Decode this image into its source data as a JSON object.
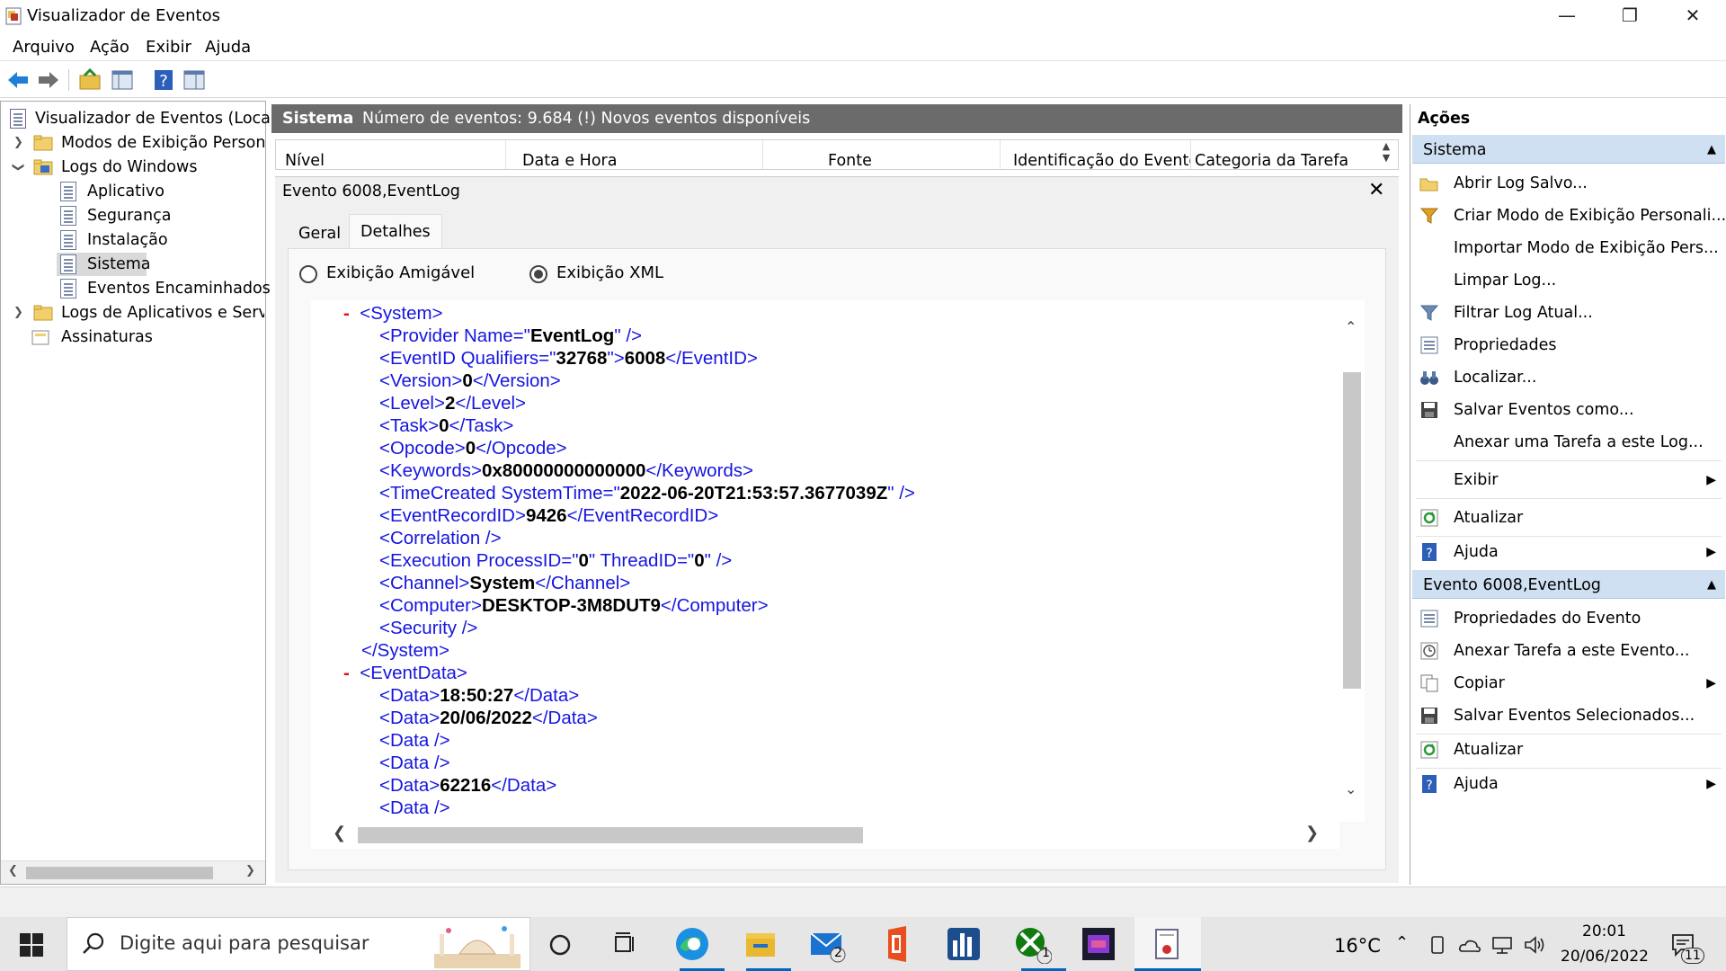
{
  "window": {
    "title": "Visualizador de Eventos"
  },
  "menu": [
    "Arquivo",
    "Ação",
    "Exibir",
    "Ajuda"
  ],
  "tree": {
    "root": "Visualizador de Eventos (Local)",
    "custom_views": "Modos de Exibição Personaliz",
    "windows_logs": "Logs do Windows",
    "app": "Aplicativo",
    "security": "Segurança",
    "setup": "Instalação",
    "system": "Sistema",
    "forwarded": "Eventos Encaminhados",
    "app_services": "Logs de Aplicativos e Serviços",
    "subscriptions": "Assinaturas"
  },
  "center": {
    "log_name": "Sistema",
    "status": "Número de eventos: 9.684 (!) Novos eventos disponíveis",
    "columns": [
      "Nível",
      "Data e Hora",
      "Fonte",
      "Identificação do Evento",
      "Categoria da Tarefa"
    ]
  },
  "event": {
    "title": "Evento 6008,EventLog",
    "tabs": [
      "Geral",
      "Detalhes"
    ],
    "radio_friendly": "Exibição Amigável",
    "radio_xml": "Exibição XML",
    "selected_view": "Exibição XML"
  },
  "xml": {
    "l1": "<System>",
    "l2_open": "<Provider Name=\"",
    "l2_val": "EventLog",
    "l2_close": "\" />",
    "l3_open": "<EventID Qualifiers=\"",
    "l3_val": "32768",
    "l3_mid": "\">",
    "l3_v2": "6008",
    "l3_close": "</EventID>",
    "l4_open": "<Version>",
    "l4_val": "0",
    "l4_close": "</Version>",
    "l5_open": "<Level>",
    "l5_val": "2",
    "l5_close": "</Level>",
    "l6_open": "<Task>",
    "l6_val": "0",
    "l6_close": "</Task>",
    "l7_open": "<Opcode>",
    "l7_val": "0",
    "l7_close": "</Opcode>",
    "l8_open": "<Keywords>",
    "l8_val": "0x80000000000000",
    "l8_close": "</Keywords>",
    "l9_open": "<TimeCreated SystemTime=\"",
    "l9_val": "2022-06-20T21:53:57.3677039Z",
    "l9_close": "\" />",
    "l10_open": "<EventRecordID>",
    "l10_val": "9426",
    "l10_close": "</EventRecordID>",
    "l11": "<Correlation />",
    "l12_open": "<Execution ProcessID=\"",
    "l12_val": "0",
    "l12_mid": "\" ThreadID=\"",
    "l12_v2": "0",
    "l12_close": "\" />",
    "l13_open": "<Channel>",
    "l13_val": "System",
    "l13_close": "</Channel>",
    "l14_open": "<Computer>",
    "l14_val": "DESKTOP-3M8DUT9",
    "l14_close": "</Computer>",
    "l15": "<Security />",
    "l16": "</System>",
    "l17": "<EventData>",
    "l18_open": "<Data>",
    "l18_val": "18:50:27",
    "l18_close": "</Data>",
    "l19_open": "<Data>",
    "l19_val": "20/06/2022",
    "l19_close": "</Data>",
    "l20": "<Data />",
    "l21": "<Data />",
    "l22_open": "<Data>",
    "l22_val": "62216",
    "l22_close": "</Data>",
    "l23": "<Data />",
    "minus": "-"
  },
  "actions": {
    "title": "Ações",
    "section1": "Sistema",
    "items1": [
      "Abrir Log Salvo...",
      "Criar Modo de Exibição Personali...",
      "Importar Modo de Exibição Pers...",
      "Limpar Log...",
      "Filtrar Log Atual...",
      "Propriedades",
      "Localizar...",
      "Salvar Eventos como...",
      "Anexar uma Tarefa a este Log...",
      "Exibir",
      "Atualizar",
      "Ajuda"
    ],
    "section2": "Evento 6008,EventLog",
    "items2": [
      "Propriedades do Evento",
      "Anexar Tarefa a este Evento...",
      "Copiar",
      "Salvar Eventos Selecionados...",
      "Atualizar",
      "Ajuda"
    ]
  },
  "taskbar": {
    "search_placeholder": "Digite aqui para pesquisar",
    "temperature": "16°C",
    "time": "20:01",
    "date": "20/06/2022",
    "mail_badge": "2",
    "xbox_badge": "1",
    "notif_badge": "11"
  }
}
